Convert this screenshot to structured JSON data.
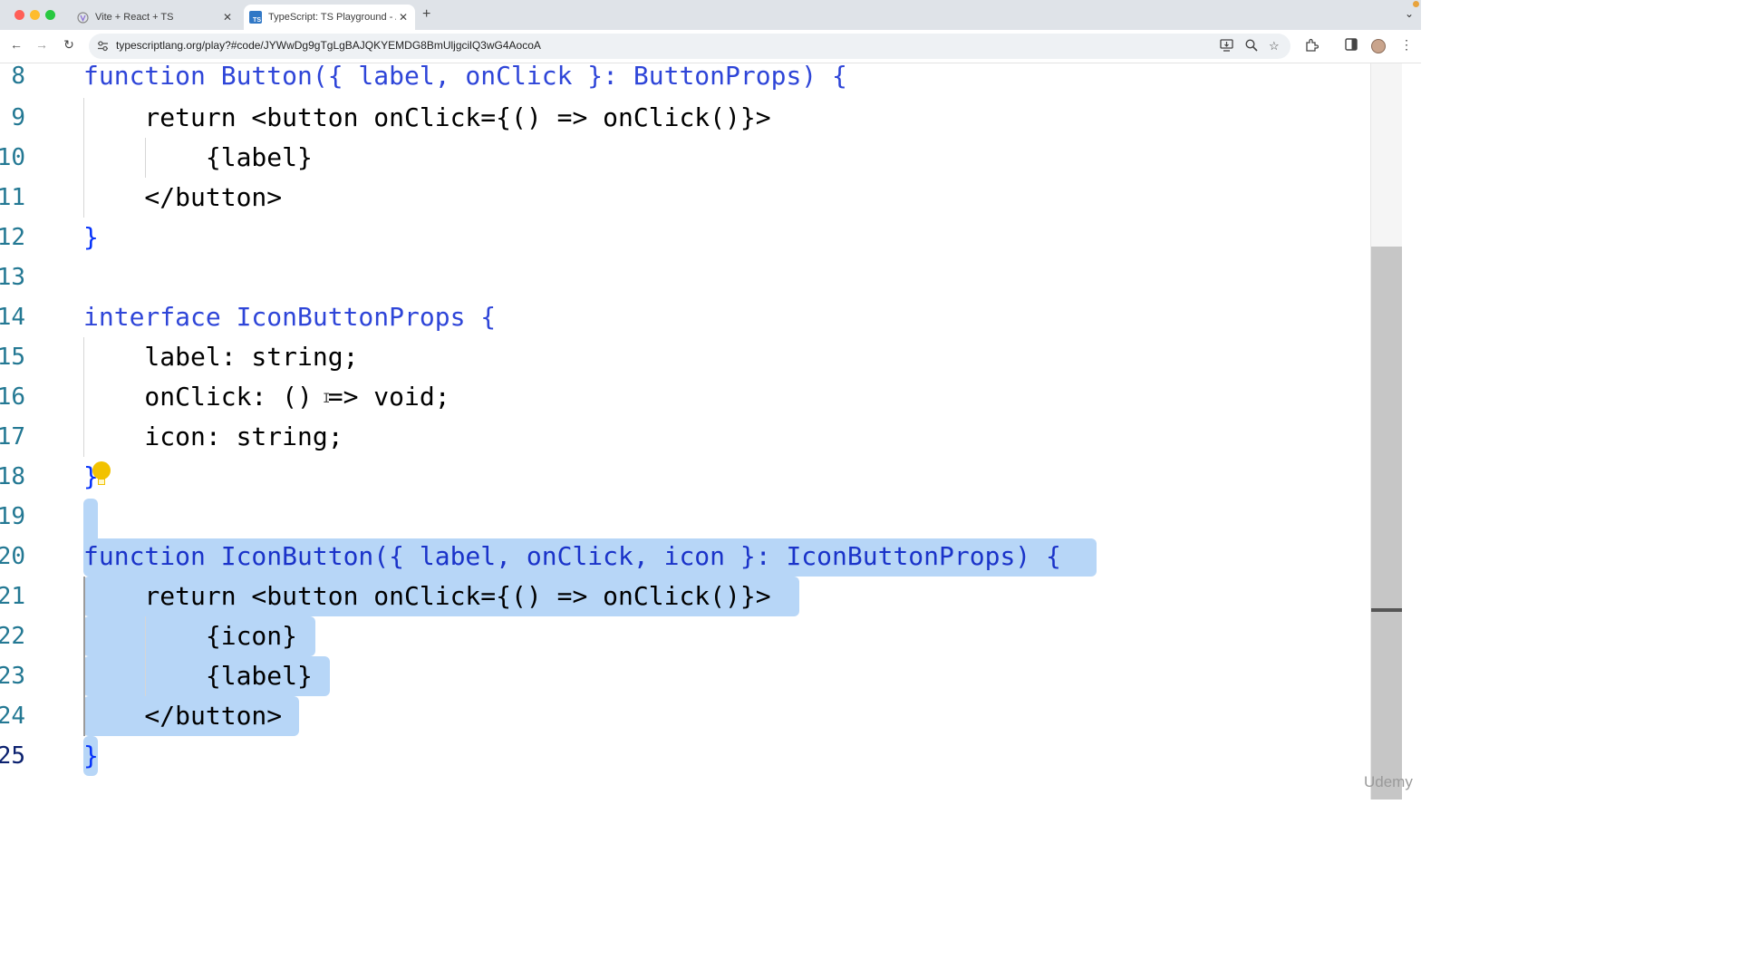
{
  "browser": {
    "tabs": [
      {
        "title": "Vite + React + TS",
        "active": false
      },
      {
        "title": "TypeScript: TS Playground - /",
        "active": true
      }
    ],
    "new_tab_label": "+",
    "url": "typescriptlang.org/play?#code/JYWwDg9gTgLgBAJQKYEMDG8BmUljgcilQ3wG4AocoA"
  },
  "editor": {
    "lines": [
      {
        "num": "8",
        "text": "function Button({ label, onClick }: ButtonProps) {"
      },
      {
        "num": "9",
        "text": "    return <button onClick={() => onClick()}>"
      },
      {
        "num": "10",
        "text": "        {label}"
      },
      {
        "num": "11",
        "text": "    </button>"
      },
      {
        "num": "12",
        "text": "}"
      },
      {
        "num": "13",
        "text": ""
      },
      {
        "num": "14",
        "text": "interface IconButtonProps {"
      },
      {
        "num": "15",
        "text": "    label: string;"
      },
      {
        "num": "16",
        "text": "    onClick: () => void;"
      },
      {
        "num": "17",
        "text": "    icon: string;"
      },
      {
        "num": "18",
        "text": "}"
      },
      {
        "num": "19",
        "text": ""
      },
      {
        "num": "20",
        "text": "function IconButton({ label, onClick, icon }: IconButtonProps) {"
      },
      {
        "num": "21",
        "text": "    return <button onClick={() => onClick()}>"
      },
      {
        "num": "22",
        "text": "        {icon}"
      },
      {
        "num": "23",
        "text": "        {label}"
      },
      {
        "num": "24",
        "text": "    </button>"
      },
      {
        "num": "25",
        "text": "}"
      }
    ],
    "selected_lines": [
      "19",
      "20",
      "21",
      "22",
      "23",
      "24",
      "25"
    ]
  },
  "colors": {
    "keyword": "#0000ff",
    "selection": "#b7d6f7",
    "line_number": "#237893",
    "type": "#267f99"
  },
  "icons": [
    "back-arrow-icon",
    "forward-arrow-icon",
    "reload-icon",
    "site-info-icon",
    "install-icon",
    "zoom-icon",
    "star-icon",
    "extensions-icon",
    "side-panel-icon",
    "menu-icon",
    "lightbulb-icon"
  ],
  "watermark": "Udemy"
}
